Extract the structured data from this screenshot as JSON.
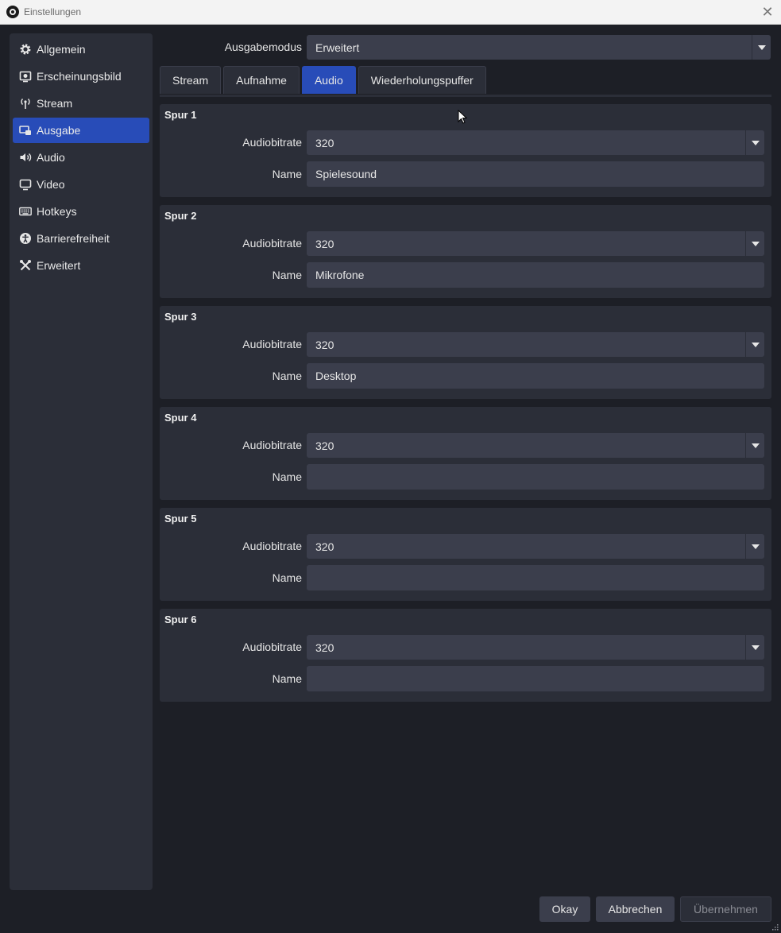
{
  "window": {
    "title": "Einstellungen"
  },
  "sidebar": {
    "items": [
      {
        "label": "Allgemein",
        "icon": "gear-icon",
        "active": false
      },
      {
        "label": "Erscheinungsbild",
        "icon": "palette-icon",
        "active": false
      },
      {
        "label": "Stream",
        "icon": "antenna-icon",
        "active": false
      },
      {
        "label": "Ausgabe",
        "icon": "output-icon",
        "active": true
      },
      {
        "label": "Audio",
        "icon": "speaker-icon",
        "active": false
      },
      {
        "label": "Video",
        "icon": "monitor-icon",
        "active": false
      },
      {
        "label": "Hotkeys",
        "icon": "keyboard-icon",
        "active": false
      },
      {
        "label": "Barrierefreiheit",
        "icon": "accessibility-icon",
        "active": false
      },
      {
        "label": "Erweitert",
        "icon": "tools-icon",
        "active": false
      }
    ]
  },
  "output_mode": {
    "label": "Ausgabemodus",
    "value": "Erweitert"
  },
  "tabs": [
    {
      "label": "Stream",
      "active": false
    },
    {
      "label": "Aufnahme",
      "active": false
    },
    {
      "label": "Audio",
      "active": true
    },
    {
      "label": "Wiederholungspuffer",
      "active": false
    }
  ],
  "tracks": [
    {
      "title": "Spur 1",
      "bitrate_label": "Audiobitrate",
      "bitrate": "320",
      "name_label": "Name",
      "name": "Spielesound"
    },
    {
      "title": "Spur 2",
      "bitrate_label": "Audiobitrate",
      "bitrate": "320",
      "name_label": "Name",
      "name": "Mikrofone"
    },
    {
      "title": "Spur 3",
      "bitrate_label": "Audiobitrate",
      "bitrate": "320",
      "name_label": "Name",
      "name": "Desktop"
    },
    {
      "title": "Spur 4",
      "bitrate_label": "Audiobitrate",
      "bitrate": "320",
      "name_label": "Name",
      "name": ""
    },
    {
      "title": "Spur 5",
      "bitrate_label": "Audiobitrate",
      "bitrate": "320",
      "name_label": "Name",
      "name": ""
    },
    {
      "title": "Spur 6",
      "bitrate_label": "Audiobitrate",
      "bitrate": "320",
      "name_label": "Name",
      "name": ""
    }
  ],
  "buttons": {
    "okay": "Okay",
    "cancel": "Abbrechen",
    "apply": "Übernehmen"
  },
  "colors": {
    "accent": "#284cb8",
    "background": "#1d1f26",
    "panel": "#2b2e38",
    "field": "#3b3e4c"
  }
}
